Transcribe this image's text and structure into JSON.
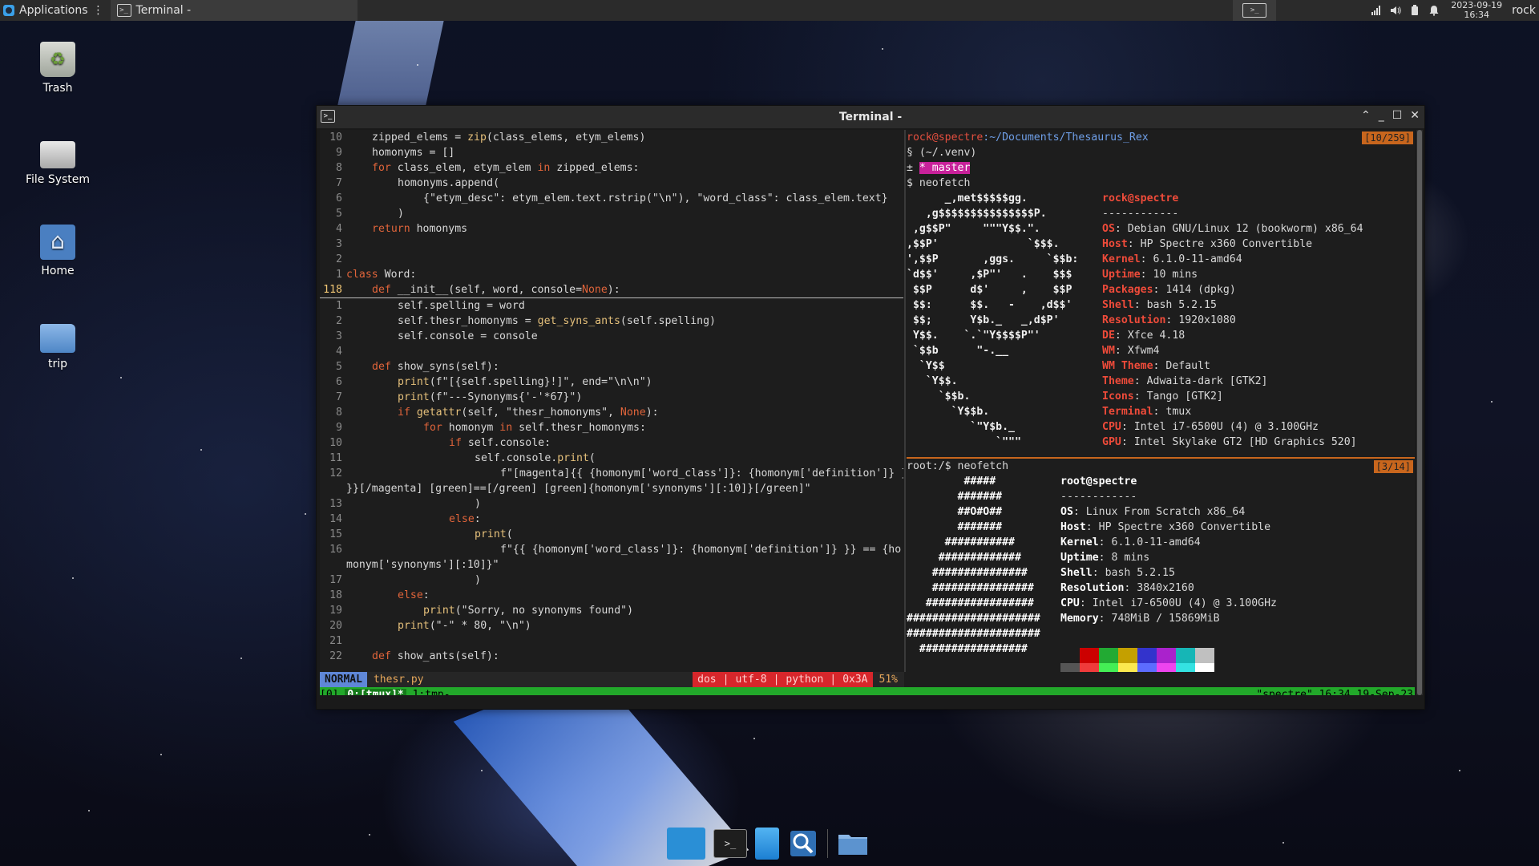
{
  "top_panel": {
    "applications_label": "Applications",
    "task_title": "Terminal -",
    "clock_date": "2023-09-19",
    "clock_time": "16:34",
    "user": "rock"
  },
  "desktop": {
    "icons": [
      {
        "label": "Trash"
      },
      {
        "label": "File System"
      },
      {
        "label": "Home"
      },
      {
        "label": "trip"
      }
    ]
  },
  "window": {
    "title": "Terminal -",
    "controls": {
      "minimize": "⌃",
      "iconify": "_",
      "maximize": "☐",
      "close": "✕"
    }
  },
  "editor": {
    "lines": [
      {
        "n": "10",
        "indent": 1,
        "text": "zipped_elems = zip(class_elems, etym_elems)"
      },
      {
        "n": "9",
        "indent": 1,
        "text": "homonyms = []"
      },
      {
        "n": "8",
        "indent": 1,
        "text": "for class_elem, etym_elem in zipped_elems:"
      },
      {
        "n": "7",
        "indent": 2,
        "text": "homonyms.append("
      },
      {
        "n": "6",
        "indent": 3,
        "text": "{\"etym_desc\": etym_elem.text.rstrip(\"\\n\"), \"word_class\": class_elem.text}"
      },
      {
        "n": "5",
        "indent": 2,
        "text": ")"
      },
      {
        "n": "4",
        "indent": 1,
        "text": "return homonyms"
      },
      {
        "n": "3",
        "indent": 0,
        "text": ""
      },
      {
        "n": "2",
        "indent": 0,
        "text": ""
      },
      {
        "n": "1",
        "indent": 0,
        "text": "class Word:"
      },
      {
        "n": "118",
        "indent": 1,
        "text": "def __init__(self, word, console=None):",
        "current": true
      },
      {
        "n": "1",
        "indent": 2,
        "text": "self.spelling = word"
      },
      {
        "n": "2",
        "indent": 2,
        "text": "self.thesr_homonyms = get_syns_ants(self.spelling)"
      },
      {
        "n": "3",
        "indent": 2,
        "text": "self.console = console"
      },
      {
        "n": "4",
        "indent": 0,
        "text": ""
      },
      {
        "n": "5",
        "indent": 1,
        "text": "def show_syns(self):"
      },
      {
        "n": "6",
        "indent": 2,
        "text": "print(f\"[{self.spelling}!]\", end=\"\\n\\n\")"
      },
      {
        "n": "7",
        "indent": 2,
        "text": "print(f\"---Synonyms{'-'*67}\")"
      },
      {
        "n": "8",
        "indent": 2,
        "text": "if getattr(self, \"thesr_homonyms\", None):"
      },
      {
        "n": "9",
        "indent": 3,
        "text": "for homonym in self.thesr_homonyms:"
      },
      {
        "n": "10",
        "indent": 4,
        "text": "if self.console:"
      },
      {
        "n": "11",
        "indent": 5,
        "text": "self.console.print("
      },
      {
        "n": "12",
        "indent": 6,
        "text": "f\"[magenta]{{ {homonym['word_class']}: {homonym['definition']} }"
      },
      {
        "n": "",
        "indent": 0,
        "text": "}}[/magenta] [green]==[/green] [green]{homonym['synonyms'][:10]}[/green]\""
      },
      {
        "n": "13",
        "indent": 5,
        "text": ")"
      },
      {
        "n": "14",
        "indent": 4,
        "text": "else:"
      },
      {
        "n": "15",
        "indent": 5,
        "text": "print("
      },
      {
        "n": "16",
        "indent": 6,
        "text": "f\"{{ {homonym['word_class']}: {homonym['definition']} }} == {ho"
      },
      {
        "n": "",
        "indent": 0,
        "text": "monym['synonyms'][:10]}\""
      },
      {
        "n": "17",
        "indent": 5,
        "text": ")"
      },
      {
        "n": "18",
        "indent": 2,
        "text": "else:"
      },
      {
        "n": "19",
        "indent": 3,
        "text": "print(\"Sorry, no synonyms found\")"
      },
      {
        "n": "20",
        "indent": 2,
        "text": "print(\"-\" * 80, \"\\n\")"
      },
      {
        "n": "21",
        "indent": 0,
        "text": ""
      },
      {
        "n": "22",
        "indent": 1,
        "text": "def show_ants(self):"
      }
    ],
    "status": {
      "mode": "NORMAL",
      "filename": "thesr.py",
      "format": "dos",
      "encoding": "utf-8",
      "filetype": "python",
      "char": "0x3A",
      "percent": "51%"
    }
  },
  "pane_top_right": {
    "badge": "[10/259]",
    "prompt_user": "rock@spectre",
    "prompt_path": ":~/Documents/Thesaurus_Rex",
    "venv": "§ (~/.venv)",
    "branch_prefix": "±",
    "branch": "* master",
    "command": "$ neofetch",
    "art": "      _,met$$$$$gg.\n   ,g$$$$$$$$$$$$$$$P.\n ,g$$P\"     \"\"\"Y$$.\".\n,$$P'              `$$$.\n',$$P       ,ggs.     `$$b:\n`d$$'     ,$P\"'   .    $$$\n $$P      d$'     ,    $$P\n $$:      $$.   -    ,d$$'\n $$;      Y$b._   _,d$P'\n Y$$.    `.`\"Y$$$$P\"'\n `$$b      \"-.__\n  `Y$$\n   `Y$$.\n     `$$b.\n       `Y$$b.\n          `\"Y$b._\n              `\"\"\"",
    "user_host": "rock@spectre",
    "separator": "------------",
    "info": [
      {
        "k": "OS",
        "v": "Debian GNU/Linux 12 (bookworm) x86_64"
      },
      {
        "k": "Host",
        "v": "HP Spectre x360 Convertible"
      },
      {
        "k": "Kernel",
        "v": "6.1.0-11-amd64"
      },
      {
        "k": "Uptime",
        "v": "10 mins"
      },
      {
        "k": "Packages",
        "v": "1414 (dpkg)"
      },
      {
        "k": "Shell",
        "v": "bash 5.2.15"
      },
      {
        "k": "Resolution",
        "v": "1920x1080"
      },
      {
        "k": "DE",
        "v": "Xfce 4.18"
      },
      {
        "k": "WM",
        "v": "Xfwm4"
      },
      {
        "k": "WM Theme",
        "v": "Default"
      },
      {
        "k": "Theme",
        "v": "Adwaita-dark [GTK2]"
      },
      {
        "k": "Icons",
        "v": "Tango [GTK2]"
      },
      {
        "k": "Terminal",
        "v": "tmux"
      },
      {
        "k": "CPU",
        "v": "Intel i7-6500U (4) @ 3.100GHz"
      },
      {
        "k": "GPU",
        "v": "Intel Skylake GT2 [HD Graphics 520]"
      }
    ]
  },
  "pane_bottom_right": {
    "badge": "[3/14]",
    "command": "root:/$ neofetch",
    "art": "         #####\n        #######\n        ##O#O##\n        #######\n      ###########\n     #############\n    ###############\n    ################\n   #################\n#####################\n#####################\n  #################",
    "user_host": "root@spectre",
    "separator": "------------",
    "info": [
      {
        "k": "OS",
        "v": "Linux From Scratch x86_64"
      },
      {
        "k": "Host",
        "v": "HP Spectre x360 Convertible"
      },
      {
        "k": "Kernel",
        "v": "6.1.0-11-amd64"
      },
      {
        "k": "Uptime",
        "v": "8 mins"
      },
      {
        "k": "Shell",
        "v": "bash 5.2.15"
      },
      {
        "k": "Resolution",
        "v": "3840x2160"
      },
      {
        "k": "CPU",
        "v": "Intel i7-6500U (4) @ 3.100GHz"
      },
      {
        "k": "Memory",
        "v": "748MiB / 15869MiB"
      }
    ],
    "palette_top": [
      "#1d1d1d",
      "#cc0000",
      "#22aa33",
      "#c4a000",
      "#3333cc",
      "#aa22cc",
      "#16b6b6",
      "#c0c0c0"
    ],
    "palette_bottom": [
      "#555555",
      "#ef3b3b",
      "#44ee55",
      "#fce94f",
      "#5c6cff",
      "#ee44ee",
      "#34e2e2",
      "#ffffff"
    ]
  },
  "tmux": {
    "session": "[0]",
    "active_window": "0:[tmux]*",
    "other_window": "1:tmp-",
    "right_status": "\"spectre\" 16:34 19-Sep-23"
  },
  "dock": {
    "items": [
      "desktop",
      "terminal",
      "files-manager",
      "app-finder",
      "file-browser"
    ]
  }
}
